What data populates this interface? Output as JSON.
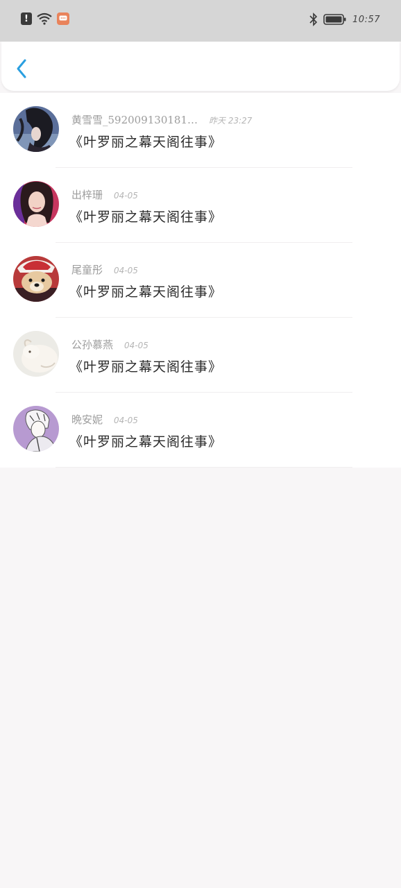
{
  "status_bar": {
    "time": "10:57",
    "icons": [
      "alert-icon",
      "wifi-icon",
      "message-notification-icon",
      "bluetooth-icon",
      "battery-icon"
    ]
  },
  "header": {
    "back_icon": "chevron-left-icon",
    "accent_color": "#2a9fe0"
  },
  "comments": [
    {
      "name": "黄雪雪_592009130181…",
      "time": "昨天 23:27",
      "content": "《叶罗丽之幕天阁往事》",
      "avatar": "dark-hair-woman"
    },
    {
      "name": "出梓珊",
      "time": "04-05",
      "content": "《叶罗丽之幕天阁往事》",
      "avatar": "woman-portrait"
    },
    {
      "name": "尾童彤",
      "time": "04-05",
      "content": "《叶罗丽之幕天阁往事》",
      "avatar": "puppy-santa-hat"
    },
    {
      "name": "公孙慕燕",
      "time": "04-05",
      "content": "《叶罗丽之幕天阁往事》",
      "avatar": "white-animal"
    },
    {
      "name": "晩安妮",
      "time": "04-05",
      "content": "《叶罗丽之幕天阁往事》",
      "avatar": "manga-character"
    }
  ]
}
